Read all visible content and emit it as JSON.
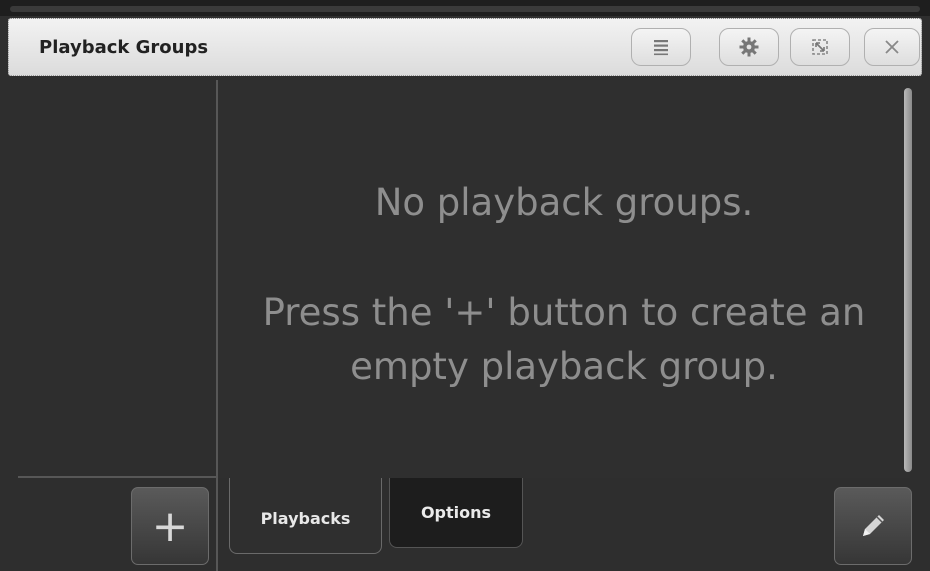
{
  "window": {
    "title": "Playback Groups"
  },
  "titlebar_buttons": [
    {
      "name": "menu-button",
      "icon": "menu-icon"
    },
    {
      "name": "settings-button",
      "icon": "gear-icon"
    },
    {
      "name": "maximize-button",
      "icon": "resize-icon"
    },
    {
      "name": "close-button",
      "icon": "close-icon"
    }
  ],
  "main": {
    "empty_line1": "No playback groups.",
    "empty_line2": "Press the '+' button to create an",
    "empty_line3": "empty playback group."
  },
  "bottom": {
    "add_label": "+",
    "tabs": [
      {
        "label": "Playbacks",
        "selected": true
      },
      {
        "label": "Options",
        "selected": false
      }
    ],
    "edit_icon": "pencil-icon"
  },
  "colors": {
    "background": "#2e2e2e",
    "titlebar": "#e6e6e6",
    "message_text": "#8e8e8e"
  }
}
